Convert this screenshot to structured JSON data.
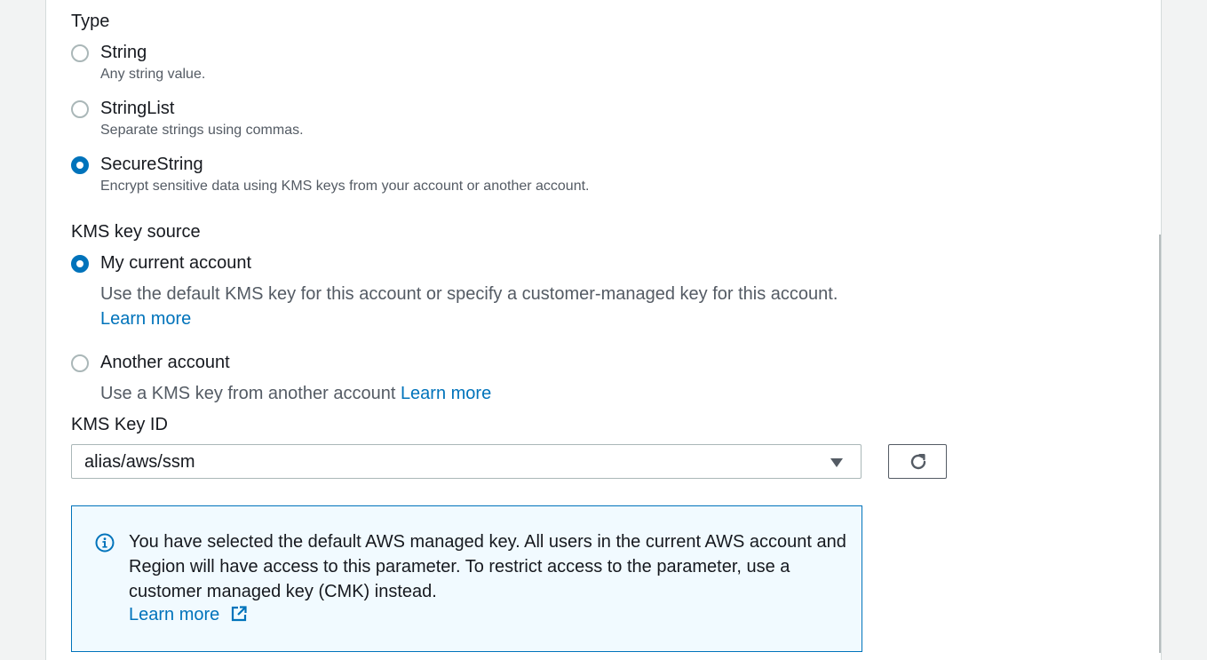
{
  "type_section": {
    "label": "Type",
    "options": [
      {
        "title": "String",
        "description": "Any string value.",
        "selected": false
      },
      {
        "title": "StringList",
        "description": "Separate strings using commas.",
        "selected": false
      },
      {
        "title": "SecureString",
        "description": "Encrypt sensitive data using KMS keys from your account or another account.",
        "selected": true
      }
    ]
  },
  "kms_source": {
    "label": "KMS key source",
    "current_account": {
      "title": "My current account",
      "description": "Use the default KMS key for this account or specify a customer-managed key for this account.",
      "link": "Learn more",
      "selected": true
    },
    "another_account": {
      "title": "Another account",
      "description": "Use a KMS key from another account",
      "link": "Learn more",
      "selected": false
    }
  },
  "kms_key": {
    "label": "KMS Key ID",
    "value": "alias/aws/ssm"
  },
  "alert": {
    "text": "You have selected the default AWS managed key. All users in the current AWS account and Region will have access to this parameter. To restrict access to the parameter, use a customer managed key (CMK) instead.",
    "link": "Learn more"
  },
  "colors": {
    "accent": "#0073bb",
    "alert_background": "#f1faff",
    "text_secondary": "#545b64"
  },
  "icons": {
    "refresh": "refresh-icon",
    "info": "info-icon",
    "external_link": "external-link-icon",
    "dropdown": "caret-down-icon"
  }
}
